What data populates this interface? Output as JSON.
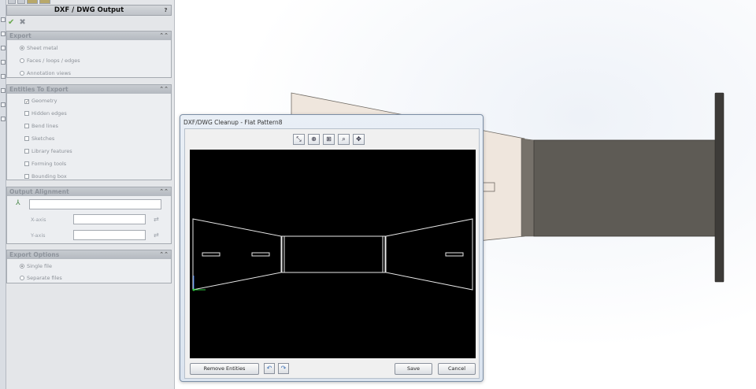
{
  "property_manager": {
    "title": "DXF / DWG Output",
    "help": "?",
    "export": {
      "header": "Export",
      "options": [
        "Sheet metal",
        "Faces / loops / edges",
        "Annotation views"
      ],
      "selected": 0
    },
    "entities": {
      "header": "Entities To Export",
      "options": [
        "Geometry",
        "Hidden edges",
        "Bend lines",
        "Sketches",
        "Library features",
        "Forming tools",
        "Bounding box"
      ],
      "checked": [
        0
      ]
    },
    "alignment": {
      "header": "Output Alignment",
      "x_label": "X-axis",
      "y_label": "Y-axis"
    },
    "export_options": {
      "header": "Export Options",
      "options": [
        "Single file",
        "Separate files"
      ],
      "selected": 0
    }
  },
  "dialog": {
    "title": "DXF/DWG Cleanup - Flat Pattern8",
    "remove_entities": "Remove Entities",
    "save": "Save",
    "cancel": "Cancel"
  },
  "icons": {
    "ok": "check-icon",
    "cancel": "x-icon",
    "collapse": "double-chevron-up-icon",
    "zoom_tools": [
      "select-icon",
      "zoom-to-fit-icon",
      "zoom-area-icon",
      "zoom-in-out-icon",
      "pan-icon"
    ]
  },
  "colors": {
    "preview_bg": "#000000",
    "preview_lines": "#e8e8e8",
    "origin_x": "#2ecc40",
    "origin_y": "#2d6cdf",
    "model_body": "#5e5b55",
    "model_flange": "#efe6dd"
  }
}
